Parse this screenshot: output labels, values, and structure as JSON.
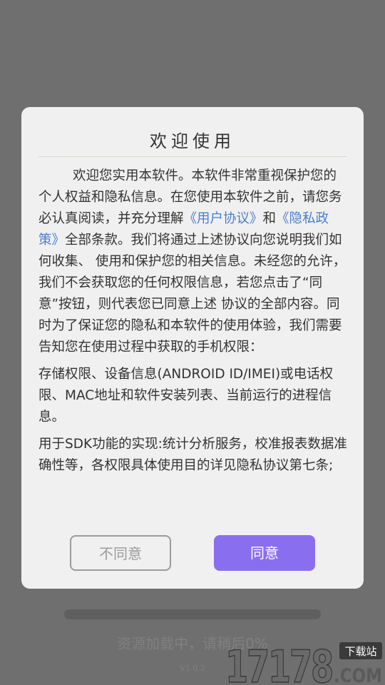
{
  "background": {
    "loading_text": "资源加载中，请稍后0%",
    "version": "V1.0.2",
    "loading_progress": 0
  },
  "watermark": {
    "logo_text": "17178",
    "badge_text": "下载站",
    "domain_text": ".COM"
  },
  "dialog": {
    "title": "欢迎使用",
    "para1": {
      "text_before": "欢迎您实用本软件。本软件非常重视保护您的个人权益和隐私信息。在您使用本软件之前，请您务必认真阅读，并充分理解",
      "link_user": "《用户协议》",
      "and": "和",
      "link_privacy": "《隐私政策》",
      "text_after": "全部条款。我们将通过上述协议向您说明我们如何收集、 使用和保护您的相关信息。未经您的允许，我们不会获取您的任何权限信息，若您点击了“同意”按钮，则代表您已同意上述 协议的全部内容。同时为了保证您的隐私和本软件的使用体验，我们需要告知您在使用过程中获取的手机权限："
    },
    "para2": "存储权限、设备信息(ANDROID ID/IMEI)或电话权限、MAC地址和软件安装列表、当前运行的进程信息。",
    "para3": "用于SDK功能的实现:统计分析服务，校准报表数据准确性等，各权限具体使用目的详见隐私协议第七条;",
    "disagree_label": "不同意",
    "agree_label": "同意"
  },
  "colors": {
    "link": "#4a7fd0",
    "agree_button": "#8a6ef0",
    "overlay": "#6f6f6f"
  }
}
